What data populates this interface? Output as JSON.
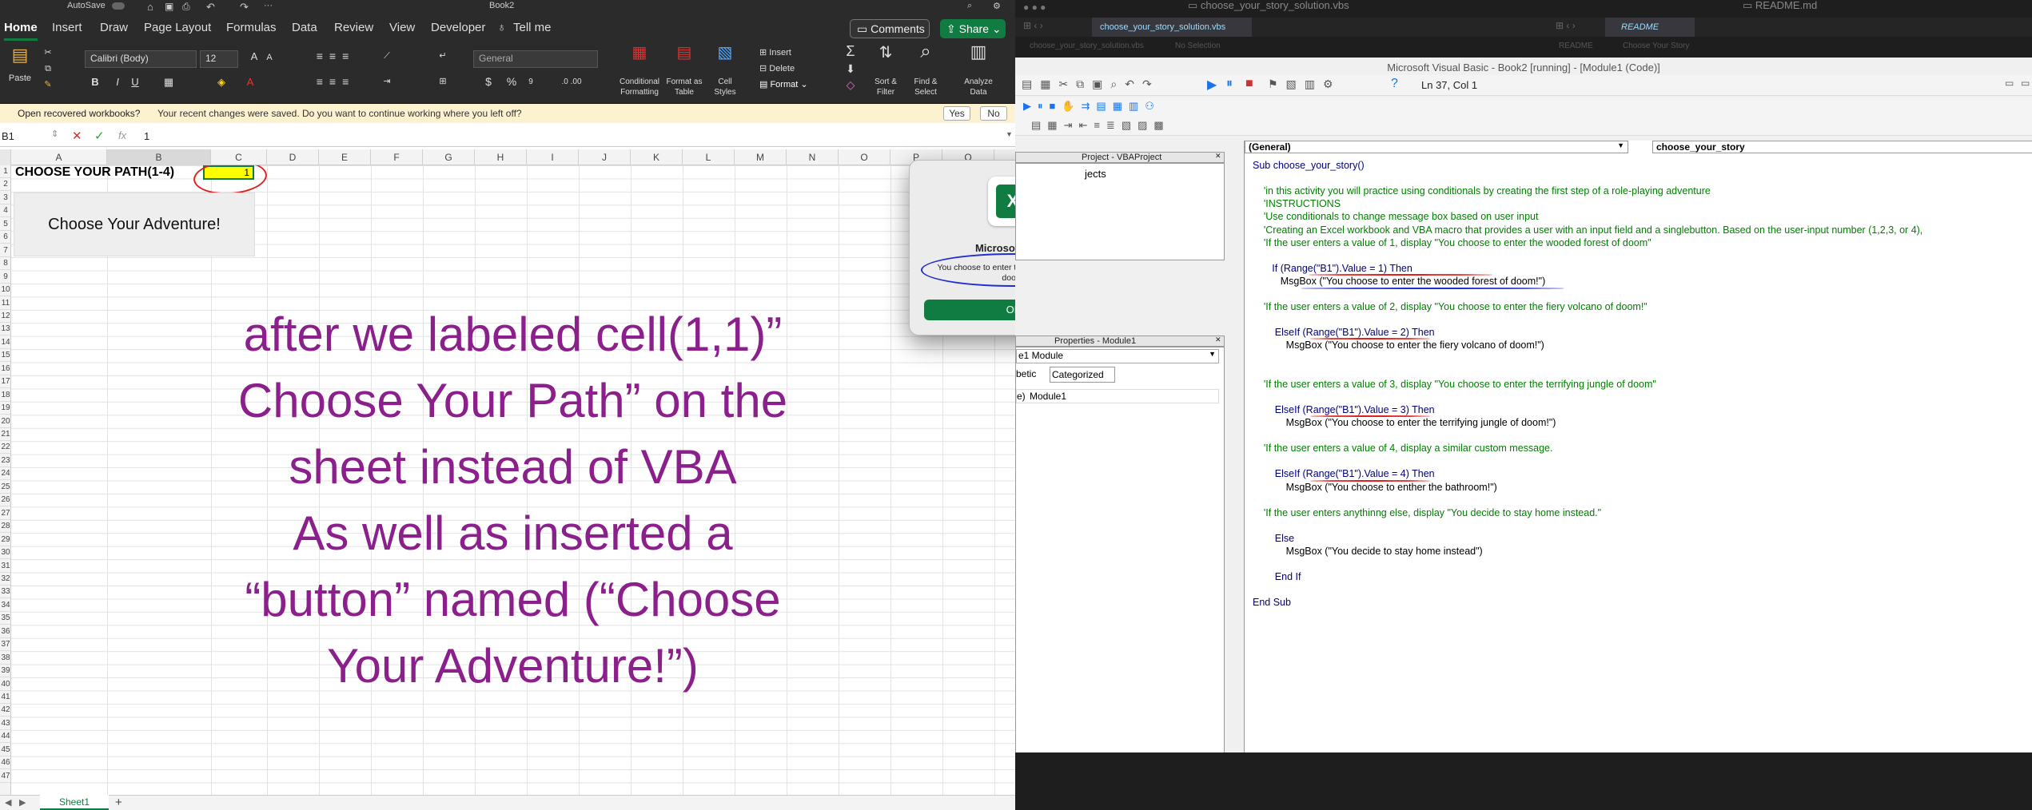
{
  "excel": {
    "titlebar": {
      "autosave_label": "AutoSave",
      "doc_title": "Book2"
    },
    "tabs": [
      "Home",
      "Insert",
      "Draw",
      "Page Layout",
      "Formulas",
      "Data",
      "Review",
      "View",
      "Developer",
      "Tell me"
    ],
    "comments_label": "Comments",
    "share_label": "Share",
    "ribbon": {
      "paste": "Paste",
      "font_name": "Calibri (Body)",
      "font_size": "12",
      "number_format": "General",
      "conditional_formatting": "Conditional Formatting",
      "format_as_table": "Format as Table",
      "cell_styles": "Cell Styles",
      "insert": "Insert",
      "delete": "Delete",
      "format": "Format",
      "sort_filter": "Sort & Filter",
      "find_select": "Find & Select",
      "analyze_data": "Analyze Data"
    },
    "message_bar": {
      "title": "Open recovered workbooks?",
      "text": "Your recent changes were saved. Do you want to continue working where you left off?",
      "yes": "Yes",
      "no": "No"
    },
    "formula_bar": {
      "name_box": "B1",
      "value": "1"
    },
    "columns": [
      "A",
      "B",
      "C",
      "D",
      "E",
      "F",
      "G",
      "H",
      "I",
      "J",
      "K",
      "L",
      "M",
      "N",
      "O",
      "P",
      "Q"
    ],
    "rows": [
      "1",
      "2",
      "3",
      "4",
      "5",
      "6",
      "7",
      "8",
      "9",
      "10",
      "11",
      "12",
      "13",
      "14",
      "15",
      "16",
      "17",
      "18",
      "19",
      "20",
      "21",
      "22",
      "23",
      "24",
      "25",
      "26",
      "27",
      "28",
      "29",
      "30",
      "31",
      "32",
      "33",
      "34",
      "35",
      "36",
      "37",
      "38",
      "39",
      "40",
      "41",
      "42",
      "43",
      "44",
      "45",
      "46",
      "47"
    ],
    "cell_a1": "CHOOSE YOUR PATH(1-4)",
    "cell_b1": "1",
    "button_label": "Choose Your Adventure!",
    "annotation": [
      "after we labeled cell(1,1)”",
      "Choose Your Path” on the",
      "sheet instead of VBA",
      "As well as inserted a",
      "“button” named (“Choose",
      "Your Adventure!”)"
    ],
    "sheet_tab": "Sheet1",
    "add_sheet": "+"
  },
  "dialog": {
    "title": "Microsoft Excel",
    "message": "You choose to enter the wooded forest of doom!",
    "ok": "OK"
  },
  "vbe": {
    "top_left_title": "choose_your_story_solution.vbs",
    "top_right_title": "README.md",
    "tab_left": "choose_your_story_solution.vbs",
    "tab_right": "README",
    "crumb_left_file": "choose_your_story_solution.vbs",
    "crumb_left_sel": "No Selection",
    "crumb_right_1": "README",
    "crumb_right_2": "Choose Your Story",
    "window_title": "Microsoft Visual Basic - Book2 [running] - [Module1 (Code)]",
    "cursor_pos": "Ln 37, Col 1",
    "project_title": "Project - VBAProject",
    "project_partial": "jects",
    "properties_title": "Properties - Module1",
    "properties_dropdown": "e1 Module",
    "tab_alpha": "betic",
    "tab_categorized": "Categorized",
    "prop_name_key": "e)",
    "prop_name_val": "Module1",
    "dropdown_general": "(General)",
    "dropdown_proc": "choose_your_story",
    "code": [
      {
        "t": "Sub choose_your_story()",
        "c": "kw"
      },
      {
        "t": "",
        "c": ""
      },
      {
        "t": "    'in this activity you will practice using conditionals by creating the first step of a role-playing adventure",
        "c": "cm"
      },
      {
        "t": "    'INSTRUCTIONS",
        "c": "cm"
      },
      {
        "t": "    'Use conditionals to change message box based on user input",
        "c": "cm"
      },
      {
        "t": "    'Creating an Excel workbook and VBA macro that provides a user with an input field and a singlebutton. Based on the user-input number (1,2,3, or 4),",
        "c": "cm"
      },
      {
        "t": "    'If the user enters a value of 1, display \"You choose to enter the wooded forest of doom\"",
        "c": "cm"
      },
      {
        "t": "",
        "c": ""
      },
      {
        "t": "       If (Range(\"B1\").Value = 1) Then",
        "c": "mix"
      },
      {
        "t": "          MsgBox (\"You choose to enter the wooded forest of doom!\")",
        "c": ""
      },
      {
        "t": "",
        "c": ""
      },
      {
        "t": "    'If the user enters a value of 2, display \"You choose to enter the fiery volcano of doom!\"",
        "c": "cm"
      },
      {
        "t": "",
        "c": ""
      },
      {
        "t": "        ElseIf (Range(\"B1\").Value = 2) Then",
        "c": "mix"
      },
      {
        "t": "            MsgBox (\"You choose to enter the fiery volcano of doom!\")",
        "c": ""
      },
      {
        "t": "",
        "c": ""
      },
      {
        "t": "",
        "c": ""
      },
      {
        "t": "    'If the user enters a value of 3, display \"You choose to enter the terrifying jungle of doom\"",
        "c": "cm"
      },
      {
        "t": "",
        "c": ""
      },
      {
        "t": "        ElseIf (Range(\"B1\").Value = 3) Then",
        "c": "mix"
      },
      {
        "t": "            MsgBox (\"You choose to enter the terrifying jungle of doom!\")",
        "c": ""
      },
      {
        "t": "",
        "c": ""
      },
      {
        "t": "    'If the user enters a value of 4, display a similar custom message.",
        "c": "cm"
      },
      {
        "t": "",
        "c": ""
      },
      {
        "t": "        ElseIf (Range(\"B1\").Value = 4) Then",
        "c": "mix"
      },
      {
        "t": "            MsgBox (\"You choose to enther the bathroom!\")",
        "c": ""
      },
      {
        "t": "",
        "c": ""
      },
      {
        "t": "    'If the user enters anythinng else, display \"You decide to stay home instead.\"",
        "c": "cm"
      },
      {
        "t": "",
        "c": ""
      },
      {
        "t": "        Else",
        "c": "kw"
      },
      {
        "t": "            MsgBox (\"You decide to stay home instead\")",
        "c": ""
      },
      {
        "t": "",
        "c": ""
      },
      {
        "t": "        End If",
        "c": "kw"
      },
      {
        "t": "",
        "c": ""
      },
      {
        "t": "End Sub",
        "c": "kw"
      }
    ]
  },
  "colors": {
    "excel_green": "#107c41",
    "annotation_purple": "#8b1f8b",
    "highlight_yellow": "#ffff00",
    "vba_keyword": "#00007f",
    "vba_comment": "#007f00",
    "annotation_red": "#e0201f",
    "annotation_blue": "#2030d0"
  }
}
